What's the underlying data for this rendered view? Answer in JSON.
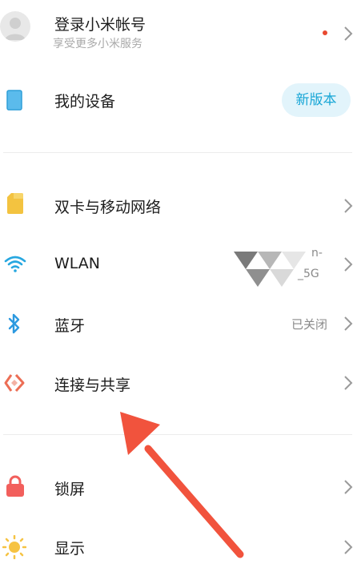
{
  "account": {
    "title": "登录小米帐号",
    "subtitle": "享受更多小米服务",
    "dot_color": "#e8482f"
  },
  "device": {
    "label": "我的设备",
    "badge": "新版本"
  },
  "network": {
    "sim": "双卡与移动网络",
    "wlan": "WLAN",
    "wlan_status_line1": "n-",
    "wlan_status_line2": "_5G",
    "bluetooth": "蓝牙",
    "bluetooth_status": "已关闭",
    "share": "连接与共享"
  },
  "system": {
    "lock": "锁屏",
    "display": "显示"
  },
  "colors": {
    "accent": "#17a6d6",
    "arrow": "#f1533d",
    "sim_icon": "#f3c340",
    "wifi_icon": "#27a7e0",
    "bluetooth_icon": "#2d9ae0",
    "share_icon": "#ec6e55",
    "lock_icon": "#f25f5c",
    "sun_icon": "#f6c343"
  },
  "icons": {
    "account": "avatar-icon",
    "device": "tablet-icon",
    "sim": "sim-card-icon",
    "wlan": "wifi-icon",
    "bluetooth": "bluetooth-icon",
    "share": "connection-share-icon",
    "lock": "lock-icon",
    "display": "sun-icon",
    "chevron": "chevron-right-icon"
  }
}
